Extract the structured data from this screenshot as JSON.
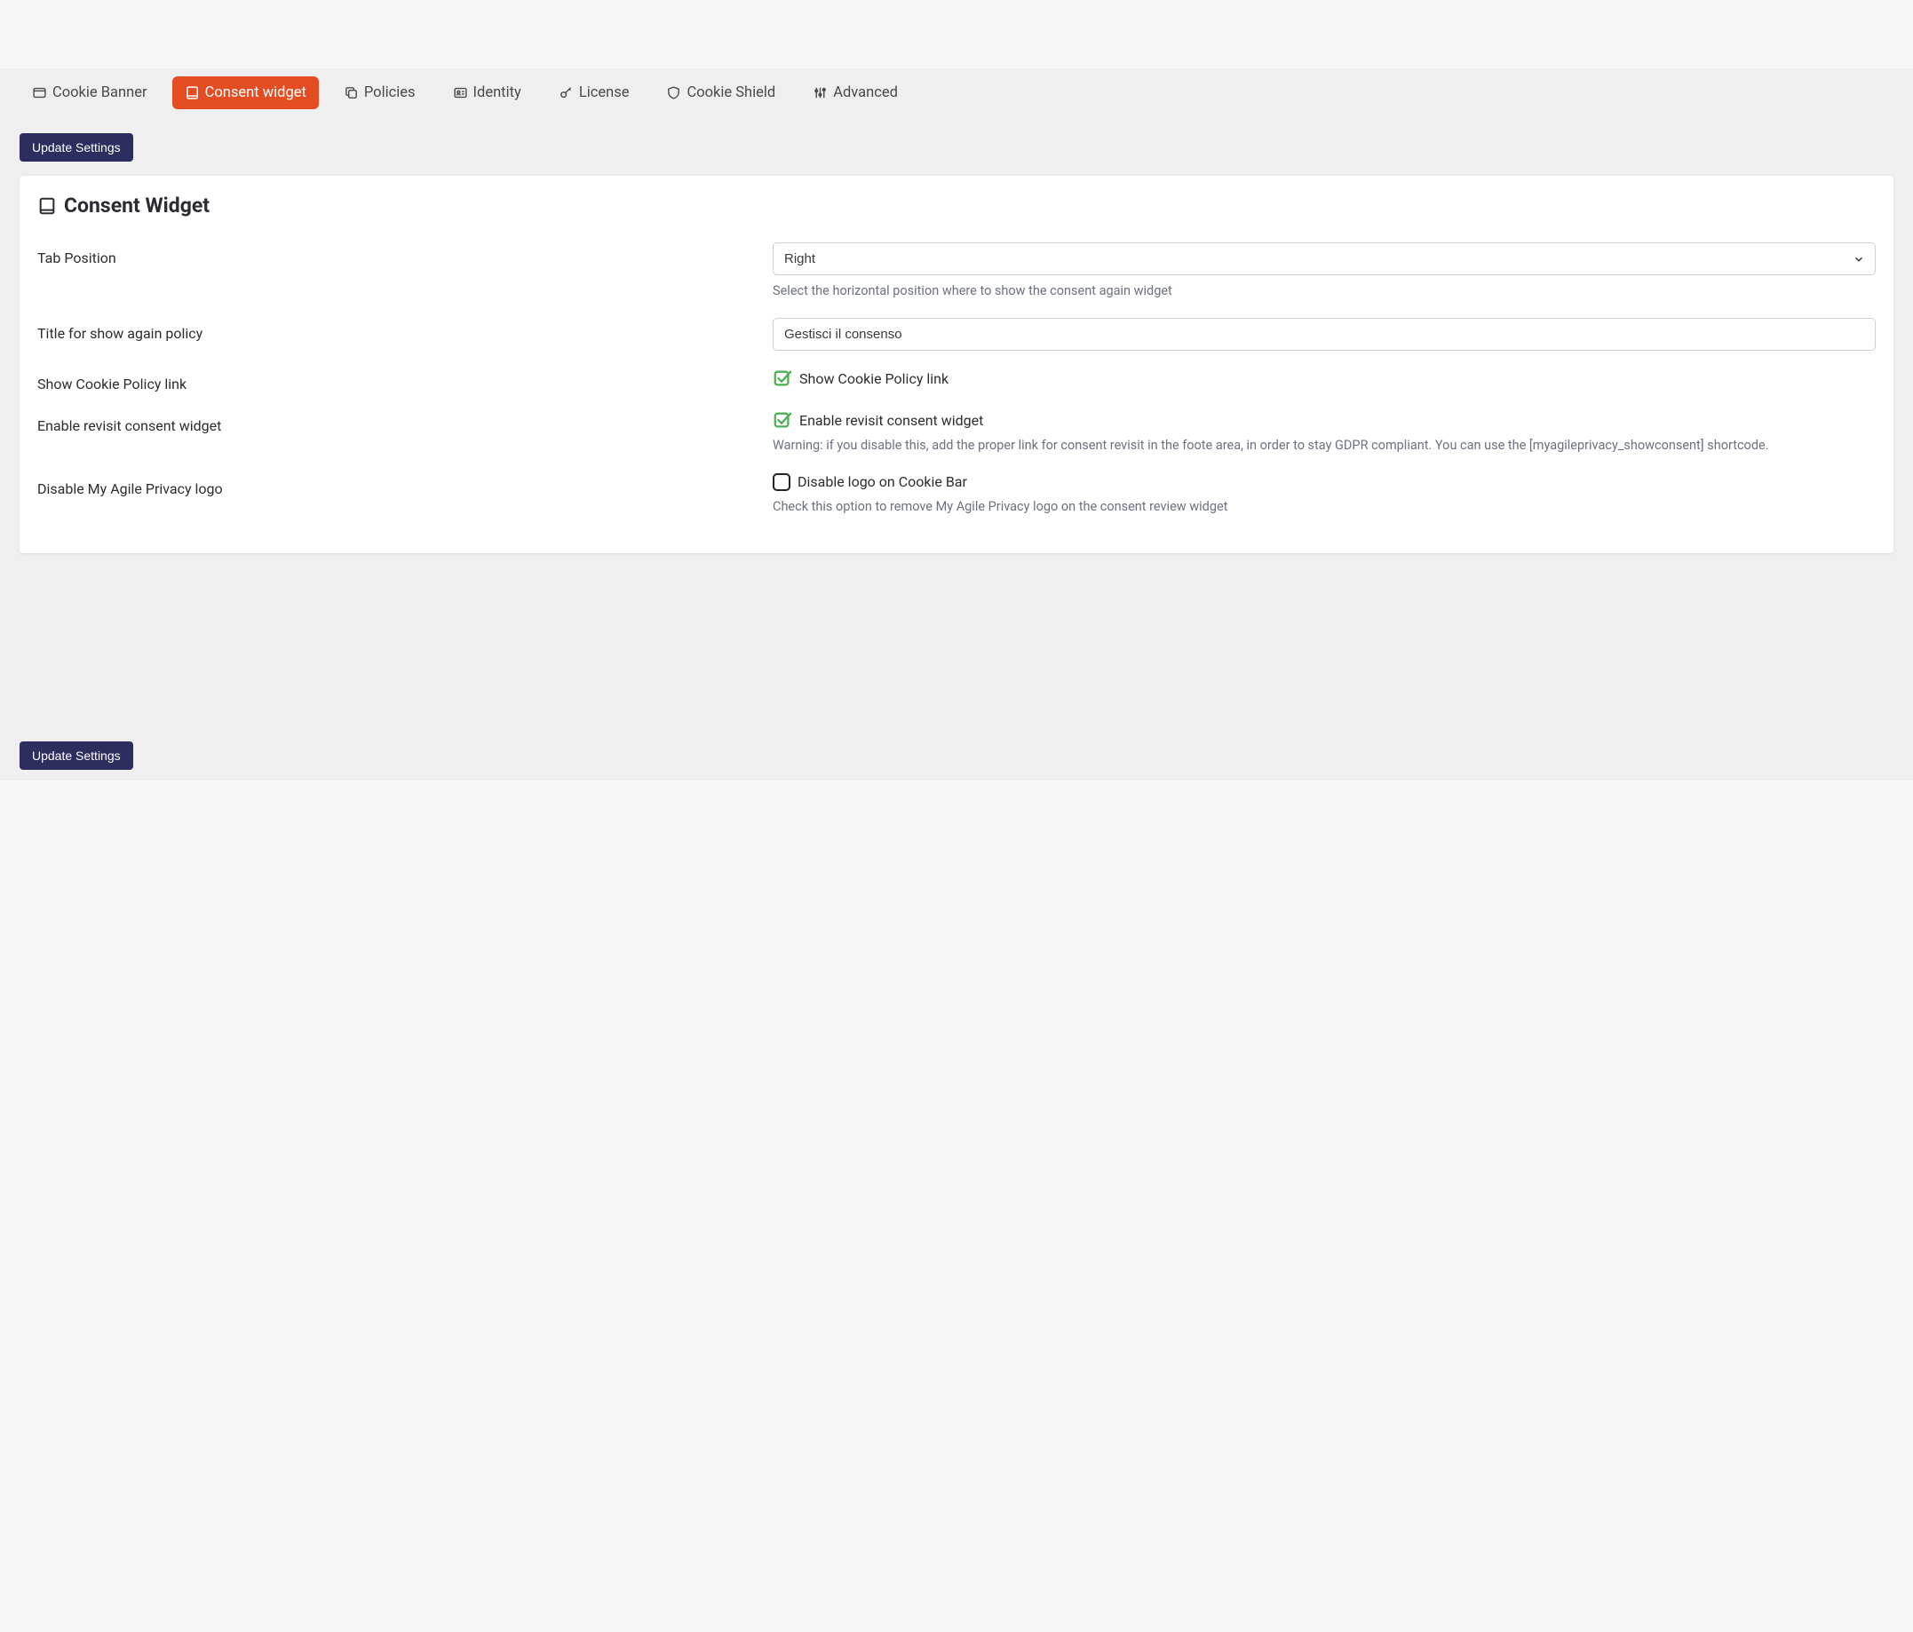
{
  "tabs": [
    {
      "label": "Cookie Banner",
      "active": false
    },
    {
      "label": "Consent widget",
      "active": true
    },
    {
      "label": "Policies",
      "active": false
    },
    {
      "label": "Identity",
      "active": false
    },
    {
      "label": "License",
      "active": false
    },
    {
      "label": "Cookie Shield",
      "active": false
    },
    {
      "label": "Advanced",
      "active": false
    }
  ],
  "buttons": {
    "update_settings": "Update Settings"
  },
  "card": {
    "title": "Consent Widget"
  },
  "fields": {
    "tab_position": {
      "label": "Tab Position",
      "value": "Right",
      "help": "Select the horizontal position where to show the consent again widget"
    },
    "title_show_again": {
      "label": "Title for show again policy",
      "value": "Gestisci il consenso"
    },
    "show_cookie_policy_link": {
      "label": "Show Cookie Policy link",
      "checkbox_label": "Show Cookie Policy link",
      "checked": true
    },
    "enable_revisit": {
      "label": "Enable revisit consent widget",
      "checkbox_label": "Enable revisit consent widget",
      "checked": true,
      "help": "Warning: if you disable this, add the proper link for consent revisit in the foote area, in order to stay GDPR compliant. You can use the [myagileprivacy_showconsent] shortcode."
    },
    "disable_logo": {
      "label": "Disable My Agile Privacy logo",
      "checkbox_label": "Disable logo on Cookie Bar",
      "checked": false,
      "help": "Check this option to remove My Agile Privacy logo on the consent review widget"
    }
  }
}
